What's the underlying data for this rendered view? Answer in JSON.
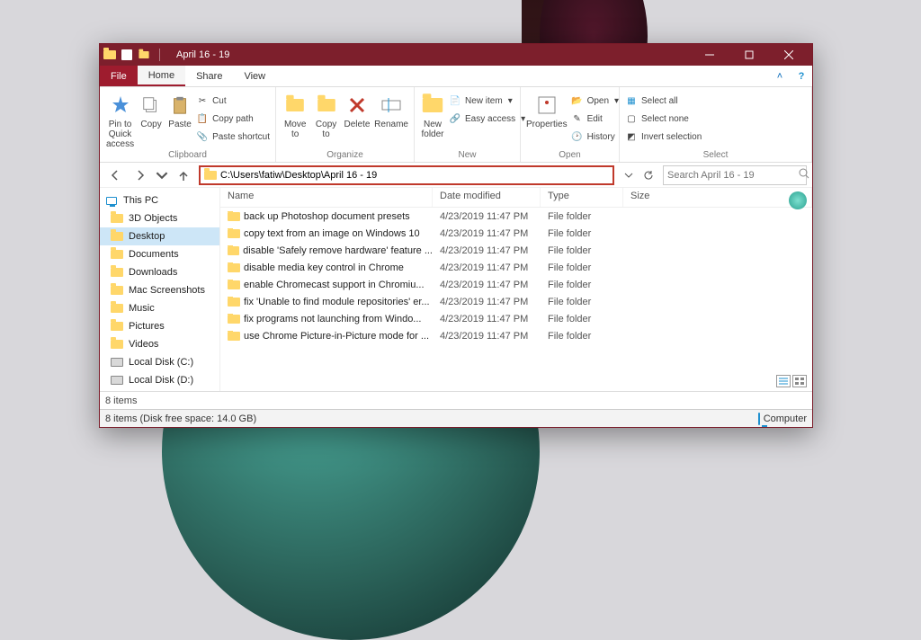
{
  "window": {
    "title": "April 16 - 19"
  },
  "menutabs": {
    "file": "File",
    "home": "Home",
    "share": "Share",
    "view": "View"
  },
  "ribbon": {
    "clipboard": {
      "label": "Clipboard",
      "pin": "Pin to Quick access",
      "copy": "Copy",
      "paste": "Paste",
      "cut": "Cut",
      "copy_path": "Copy path",
      "paste_shortcut": "Paste shortcut"
    },
    "organize": {
      "label": "Organize",
      "move_to": "Move to",
      "copy_to": "Copy to",
      "delete": "Delete",
      "rename": "Rename"
    },
    "new": {
      "label": "New",
      "new_folder": "New folder",
      "new_item": "New item",
      "easy_access": "Easy access"
    },
    "open": {
      "label": "Open",
      "properties": "Properties",
      "open": "Open",
      "edit": "Edit",
      "history": "History"
    },
    "select": {
      "label": "Select",
      "select_all": "Select all",
      "select_none": "Select none",
      "invert": "Invert selection"
    }
  },
  "address": {
    "path": "C:\\Users\\fatiw\\Desktop\\April 16 - 19"
  },
  "search": {
    "placeholder": "Search April 16 - 19"
  },
  "navpane": {
    "header": "This PC",
    "items": [
      "3D Objects",
      "Desktop",
      "Documents",
      "Downloads",
      "Mac Screenshots",
      "Music",
      "Pictures",
      "Videos",
      "Local Disk (C:)",
      "Local Disk (D:)"
    ],
    "selected_index": 1
  },
  "columns": {
    "name": "Name",
    "date": "Date modified",
    "type": "Type",
    "size": "Size"
  },
  "files": [
    {
      "name": "back up Photoshop document presets",
      "date": "4/23/2019 11:47 PM",
      "type": "File folder"
    },
    {
      "name": "copy text from an image on Windows 10",
      "date": "4/23/2019 11:47 PM",
      "type": "File folder"
    },
    {
      "name": "disable 'Safely remove hardware' feature ...",
      "date": "4/23/2019 11:47 PM",
      "type": "File folder"
    },
    {
      "name": "disable media key control in Chrome",
      "date": "4/23/2019 11:47 PM",
      "type": "File folder"
    },
    {
      "name": "enable Chromecast support in Chromiu...",
      "date": "4/23/2019 11:47 PM",
      "type": "File folder"
    },
    {
      "name": "fix 'Unable to find module repositories' er...",
      "date": "4/23/2019 11:47 PM",
      "type": "File folder"
    },
    {
      "name": "fix programs not launching from Windo...",
      "date": "4/23/2019 11:47 PM",
      "type": "File folder"
    },
    {
      "name": "use Chrome Picture-in-Picture mode for ...",
      "date": "4/23/2019 11:47 PM",
      "type": "File folder"
    }
  ],
  "status": {
    "items": "8 items",
    "disk": "8 items (Disk free space: 14.0 GB)",
    "computer": "Computer"
  }
}
